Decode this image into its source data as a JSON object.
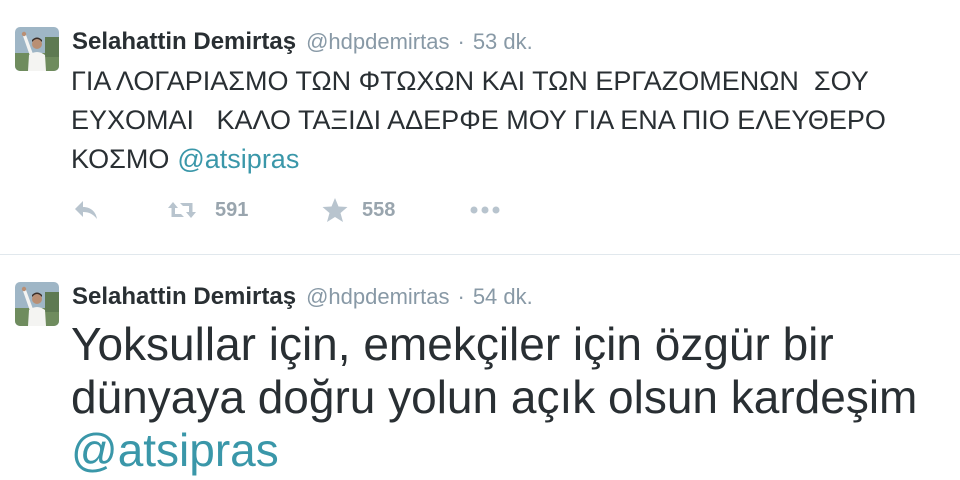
{
  "tweets": [
    {
      "name": "Selahattin Demirtaş",
      "handle": "@hdpdemirtas",
      "separator": "·",
      "time": "53 dk.",
      "text_lines": [
        "ΓΙΑ ΛΟΓΑΡΙΑΣΜΟ ΤΩΝ ΦΤΩΧΩΝ ΚΑΙ ΤΩΝ ΕΡΓΑΖΟΜΕΝΩΝ  ΣΟΥ",
        "ΕΥΧΟΜΑΙ   ΚΑΛΟ ΤΑΞΙΔΙ ΑΔΕΡΦΕ ΜΟΥ ΓΙΑ ΕΝΑ ΠΙΟ ΕΛΕΥΘΕΡΟ",
        "ΚΟΣΜΟ"
      ],
      "mention": "@atsipras",
      "actions": {
        "reply_icon": "reply-icon",
        "retweet_icon": "retweet-icon",
        "retweet_count": "591",
        "favorite_icon": "star-icon",
        "favorite_count": "558",
        "more_icon": "more-dots-icon"
      }
    },
    {
      "name": "Selahattin Demirtaş",
      "handle": "@hdpdemirtas",
      "separator": "·",
      "time": "54 dk.",
      "text_lines": [
        "Yoksullar için, emekçiler için özgür bir",
        "dünyaya doğru yolun açık olsun kardeşim"
      ],
      "mention": "@atsipras"
    }
  ],
  "colors": {
    "text": "#292f33",
    "meta": "#8899a6",
    "link": "#3a97a9",
    "icon": "#b8c4ce",
    "count": "#99a5ae",
    "divider": "#e1e8ed",
    "background": "#ffffff"
  }
}
